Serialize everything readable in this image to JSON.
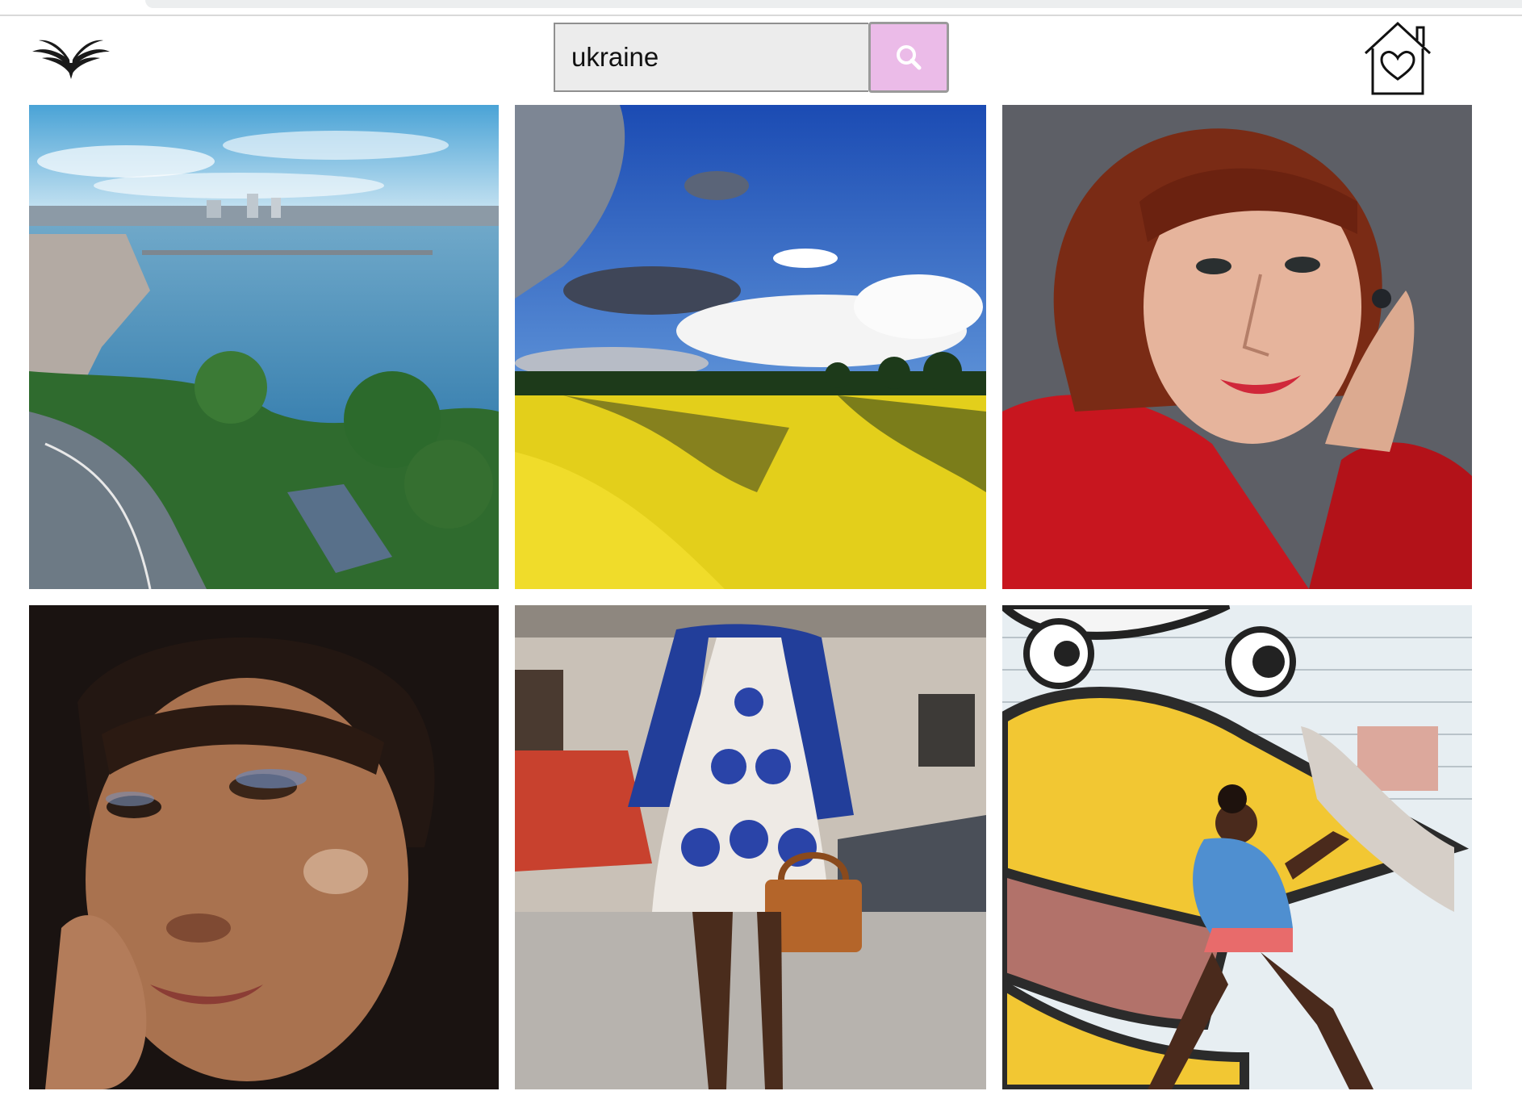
{
  "search": {
    "value": "ukraine"
  },
  "icons": {
    "logo": "wings-logo-icon",
    "search": "search-icon",
    "favorites": "home-heart-icon"
  },
  "colors": {
    "search_button_bg": "#ebbbe8",
    "search_field_bg": "#ececec"
  },
  "gallery": [
    {
      "subject": "city-river-aerial"
    },
    {
      "subject": "rapeseed-field-blue-sky"
    },
    {
      "subject": "red-haired-woman-portrait"
    },
    {
      "subject": "woman-glitter-makeup-portrait"
    },
    {
      "subject": "woman-patterned-dress-handbag"
    },
    {
      "subject": "girl-in-front-of-mural"
    }
  ]
}
